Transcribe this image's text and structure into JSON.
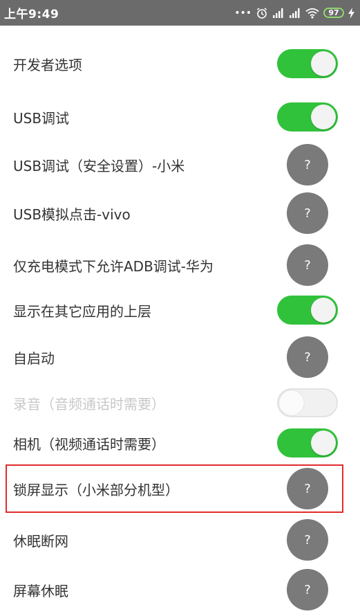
{
  "status_bar": {
    "time": "上午9:49",
    "dots": "•••",
    "battery": "97",
    "icons": [
      "alarm-icon",
      "signal-icon",
      "signal-icon",
      "wifi-icon",
      "battery-icon",
      "charging-icon"
    ]
  },
  "settings": {
    "items": [
      {
        "label": "开发者选项",
        "control": "toggle",
        "state": "on"
      },
      {
        "label": "USB调试",
        "control": "toggle",
        "state": "on"
      },
      {
        "label": "USB调试（安全设置）-小米",
        "control": "help",
        "help_text": "?"
      },
      {
        "label": "USB模拟点击-vivo",
        "control": "help",
        "help_text": "?"
      },
      {
        "label": "仅充电模式下允许ADB调试-华为",
        "control": "help",
        "help_text": "?"
      },
      {
        "label": "显示在其它应用的上层",
        "control": "toggle",
        "state": "on"
      },
      {
        "label": "自启动",
        "control": "help",
        "help_text": "?"
      },
      {
        "label": "录音（音频通话时需要）",
        "control": "toggle",
        "state": "off",
        "disabled": true
      },
      {
        "label": "相机（视频通话时需要）",
        "control": "toggle",
        "state": "on"
      },
      {
        "label": "锁屏显示（小米部分机型）",
        "control": "help",
        "help_text": "?",
        "highlighted": true
      },
      {
        "label": "休眠断网",
        "control": "help",
        "help_text": "?"
      },
      {
        "label": "屏幕休眠",
        "control": "help",
        "help_text": "?"
      }
    ]
  },
  "colors": {
    "status_bar": "#6b6b6b",
    "toggle_on": "#31c23b",
    "help_button": "#7a7a7a",
    "highlight_border": "#e02c2c"
  }
}
